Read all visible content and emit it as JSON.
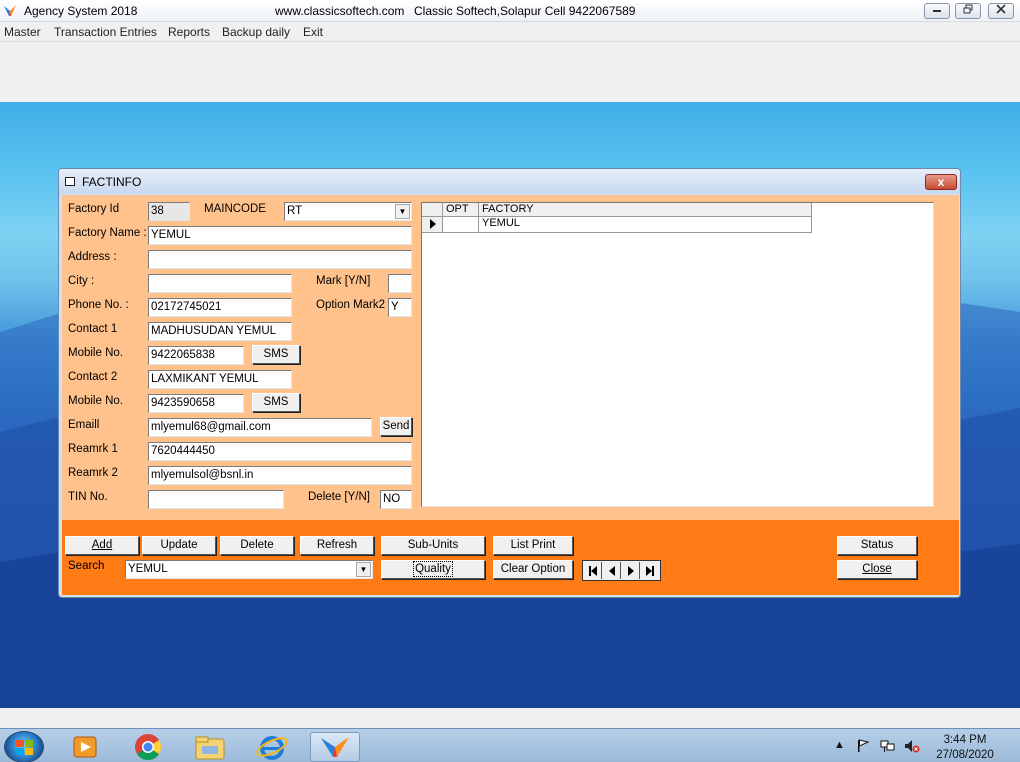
{
  "app": {
    "title": "Agency System  2018",
    "website": "www.classicsoftech.com",
    "vendor": "Classic Softech,Solapur Cell 9422067589",
    "minimize_icon": "minimize-icon",
    "maximize_icon": "restore-icon",
    "close_icon": "close-icon"
  },
  "menu": {
    "items": [
      "Master",
      "Transaction Entries",
      "Reports",
      "Backup daily",
      "Exit"
    ]
  },
  "dialog": {
    "title": "FACTINFO",
    "close_label": "x",
    "labels": {
      "factory_id": "Factory Id",
      "maincode": "MAINCODE",
      "factory_name": "Factory Name  :",
      "address": "Address :",
      "city": "City :",
      "mark": "Mark [Y/N]",
      "phone": "Phone No. :",
      "option_mark2": "Option Mark2",
      "contact1": "Contact 1",
      "mobile1": "Mobile No.",
      "contact2": "Contact 2",
      "mobile2": "Mobile No.",
      "email": "Emaill",
      "remark1": "Reamrk 1",
      "remark2": "Reamrk 2",
      "tin": "TIN No.",
      "delete_flag": "Delete [Y/N]",
      "search": "Search"
    },
    "values": {
      "factory_id": "38",
      "maincode": "RT",
      "factory_name": "YEMUL",
      "address": "",
      "city": "",
      "mark": "",
      "phone": "02172745021",
      "option_mark2": "Y",
      "contact1": "MADHUSUDAN YEMUL",
      "mobile1": "9422065838",
      "contact2": "LAXMIKANT YEMUL",
      "mobile2": "9423590658",
      "email": "mlyemul68@gmail.com",
      "remark1": "7620444450",
      "remark2": "mlyemulsol@bsnl.in",
      "tin": "",
      "delete_flag": "NO",
      "search": "YEMUL"
    },
    "buttons": {
      "sms1": "SMS",
      "sms2": "SMS",
      "send": "Send",
      "add": "Add",
      "update": "Update",
      "delete": "Delete",
      "refresh": "Refresh",
      "sub_units": "Sub-Units",
      "list_print": "List Print",
      "quality": "Quality",
      "clear_option": "Clear Option",
      "status": "Status",
      "close": "Close"
    },
    "grid": {
      "columns": [
        "OPT",
        "FACTORY"
      ],
      "rows": [
        {
          "opt": "",
          "factory": "YEMUL"
        }
      ]
    },
    "nav": [
      "first-record-icon",
      "prev-record-icon",
      "next-record-icon",
      "last-record-icon"
    ]
  },
  "taskbar": {
    "clock_time": "3:44 PM",
    "clock_date": "27/08/2020"
  }
}
